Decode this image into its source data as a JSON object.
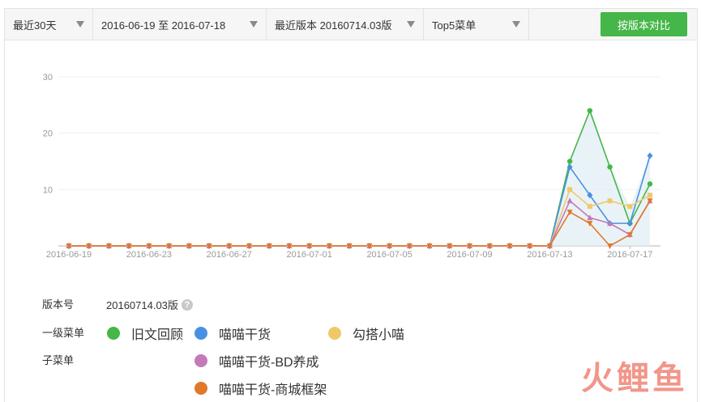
{
  "toolbar": {
    "period": "最近30天",
    "date_range": "2016-06-19 至 2016-07-18",
    "version": "最近版本 20160714.03版",
    "menu_scope": "Top5菜单",
    "compare_button": "按版本对比"
  },
  "info": {
    "version_label": "版本号",
    "version_value": "20160714.03版",
    "help_glyph": "?",
    "level1_label": "一级菜单",
    "submenu_label": "子菜单",
    "legend": [
      {
        "name": "旧文回顾",
        "color": "#45b649"
      },
      {
        "name": "喵喵干货",
        "color": "#4a90e2"
      },
      {
        "name": "勾搭小喵",
        "color": "#f0c86a"
      },
      {
        "name": "喵喵干货-BD养成",
        "color": "#c47ab8"
      },
      {
        "name": "喵喵干货-商城框架",
        "color": "#e0782a"
      }
    ]
  },
  "watermark": [
    "火",
    "鲤",
    "鱼"
  ],
  "chart_data": {
    "type": "area",
    "x": [
      "2016-06-19",
      "2016-06-20",
      "2016-06-21",
      "2016-06-22",
      "2016-06-23",
      "2016-06-24",
      "2016-06-25",
      "2016-06-26",
      "2016-06-27",
      "2016-06-28",
      "2016-06-29",
      "2016-06-30",
      "2016-07-01",
      "2016-07-02",
      "2016-07-03",
      "2016-07-04",
      "2016-07-05",
      "2016-07-06",
      "2016-07-07",
      "2016-07-08",
      "2016-07-09",
      "2016-07-10",
      "2016-07-11",
      "2016-07-12",
      "2016-07-13",
      "2016-07-14",
      "2016-07-15",
      "2016-07-16",
      "2016-07-17",
      "2016-07-18"
    ],
    "x_tick_labels": [
      "2016-06-19",
      "2016-06-23",
      "2016-06-27",
      "2016-07-01",
      "2016-07-05",
      "2016-07-09",
      "2016-07-13",
      "2016-07-17"
    ],
    "y_ticks": [
      10,
      20,
      30
    ],
    "ylim": [
      0,
      30
    ],
    "grid": true,
    "series": [
      {
        "name": "旧文回顾",
        "color": "#45b649",
        "marker": "circle",
        "values": [
          0,
          0,
          0,
          0,
          0,
          0,
          0,
          0,
          0,
          0,
          0,
          0,
          0,
          0,
          0,
          0,
          0,
          0,
          0,
          0,
          0,
          0,
          0,
          0,
          0,
          15,
          24,
          14,
          4,
          11
        ]
      },
      {
        "name": "喵喵干货",
        "color": "#4a90e2",
        "marker": "diamond",
        "values": [
          0,
          0,
          0,
          0,
          0,
          0,
          0,
          0,
          0,
          0,
          0,
          0,
          0,
          0,
          0,
          0,
          0,
          0,
          0,
          0,
          0,
          0,
          0,
          0,
          0,
          14,
          9,
          4,
          4,
          16
        ]
      },
      {
        "name": "勾搭小喵",
        "color": "#f0c86a",
        "marker": "square",
        "values": [
          0,
          0,
          0,
          0,
          0,
          0,
          0,
          0,
          0,
          0,
          0,
          0,
          0,
          0,
          0,
          0,
          0,
          0,
          0,
          0,
          0,
          0,
          0,
          0,
          0,
          10,
          7,
          8,
          7,
          9
        ]
      },
      {
        "name": "喵喵干货-BD养成",
        "color": "#c47ab8",
        "marker": "triangle",
        "values": [
          0,
          0,
          0,
          0,
          0,
          0,
          0,
          0,
          0,
          0,
          0,
          0,
          0,
          0,
          0,
          0,
          0,
          0,
          0,
          0,
          0,
          0,
          0,
          0,
          0,
          8,
          5,
          4,
          2,
          8
        ]
      },
      {
        "name": "喵喵干货-商城框架",
        "color": "#e0782a",
        "marker": "triangle-down",
        "values": [
          0,
          0,
          0,
          0,
          0,
          0,
          0,
          0,
          0,
          0,
          0,
          0,
          0,
          0,
          0,
          0,
          0,
          0,
          0,
          0,
          0,
          0,
          0,
          0,
          0,
          6,
          4,
          0,
          2,
          8
        ]
      }
    ]
  }
}
